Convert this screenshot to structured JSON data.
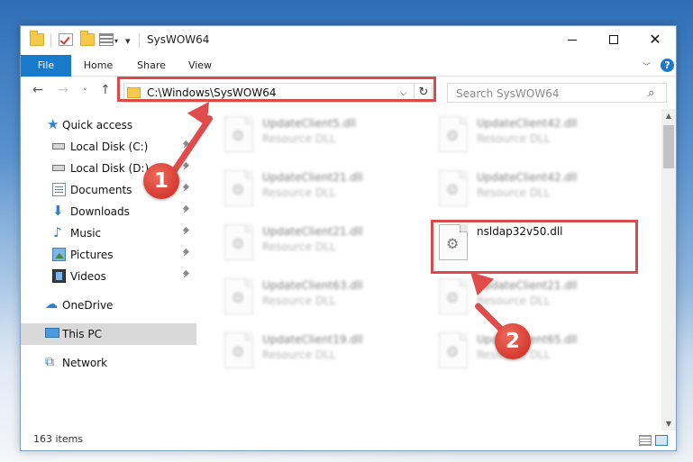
{
  "window": {
    "title": "SysWOW64",
    "minimize_glyph": "",
    "close_glyph": "✕"
  },
  "ribbon": {
    "tabs": [
      "File",
      "Home",
      "Share",
      "View"
    ],
    "help_label": "?"
  },
  "navigation": {
    "back": "←",
    "forward": "→",
    "recent": "˅",
    "up": "↑",
    "address": "C:\\Windows\\SysWOW64",
    "search_placeholder": "Search SysWOW64"
  },
  "sidebar": {
    "items": [
      {
        "label": "Quick access"
      },
      {
        "label": "Local Disk (C:)"
      },
      {
        "label": "Local Disk (D:)"
      },
      {
        "label": "Documents"
      },
      {
        "label": "Downloads"
      },
      {
        "label": "Music"
      },
      {
        "label": "Pictures"
      },
      {
        "label": "Videos"
      },
      {
        "label": "OneDrive"
      },
      {
        "label": "This PC"
      },
      {
        "label": "Network"
      }
    ],
    "selected": "This PC"
  },
  "files": [
    {
      "name": "UpdateClient5.dll",
      "type": "Resource DLL"
    },
    {
      "name": "UpdateClient42.dll",
      "type": "Resource DLL"
    },
    {
      "name": "UpdateClient21.dll",
      "type": "Resource DLL"
    },
    {
      "name": "UpdateClient42.dll",
      "type": "Resource DLL"
    },
    {
      "name": "UpdateClient21.dll",
      "type": "Resource DLL"
    },
    {
      "name": "nsldap32v50.dll",
      "type": ""
    },
    {
      "name": "UpdateClient63.dll",
      "type": "Resource DLL"
    },
    {
      "name": "UpdateClient21.dll",
      "type": "Resource DLL"
    },
    {
      "name": "UpdateClient19.dll",
      "type": "Resource DLL"
    },
    {
      "name": "UpdateClient65.dll",
      "type": "Resource DLL"
    }
  ],
  "status": {
    "item_count": "163 items"
  },
  "annotations": {
    "badge_1": "1",
    "badge_2": "2"
  },
  "colors": {
    "accent": "#1979ca",
    "annotation_red": "#d94a4a"
  }
}
